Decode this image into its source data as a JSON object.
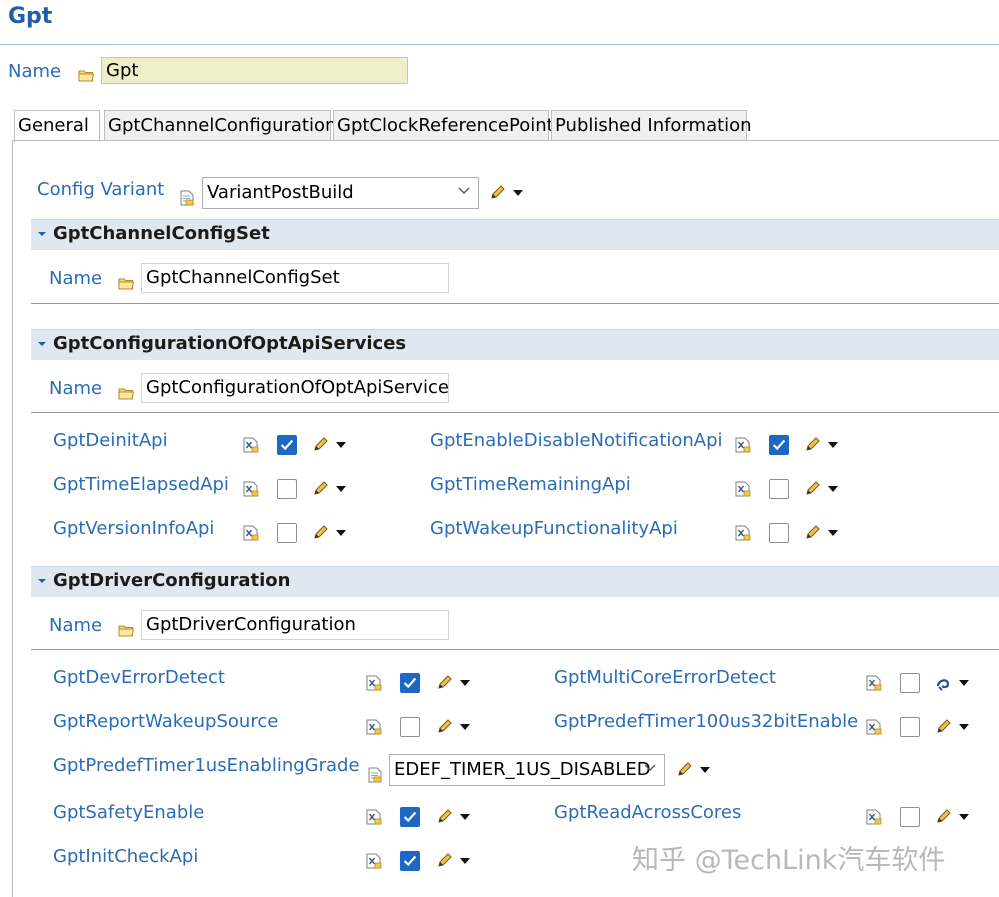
{
  "page_title": "Gpt",
  "name_label": "Name",
  "name_value": "Gpt",
  "tabs": [
    {
      "label": "General",
      "active": true
    },
    {
      "label": "GptChannelConfiguration",
      "active": false
    },
    {
      "label": "GptClockReferencePoint",
      "active": false
    },
    {
      "label": "Published Information",
      "active": false
    }
  ],
  "config_variant": {
    "label": "Config Variant",
    "value": "VariantPostBuild"
  },
  "channel_config_set": {
    "title": "GptChannelConfigSet",
    "name_label": "Name",
    "name_value": "GptChannelConfigSet"
  },
  "opt_api_services": {
    "title": "GptConfigurationOfOptApiServices",
    "name_label": "Name",
    "name_value": "GptConfigurationOfOptApiServices",
    "params": [
      {
        "label": "GptDeinitApi",
        "checked": true
      },
      {
        "label": "GptEnableDisableNotificationApi",
        "checked": true
      },
      {
        "label": "GptTimeElapsedApi",
        "checked": false
      },
      {
        "label": "GptTimeRemainingApi",
        "checked": false
      },
      {
        "label": "GptVersionInfoApi",
        "checked": false
      },
      {
        "label": "GptWakeupFunctionalityApi",
        "checked": false
      }
    ]
  },
  "driver_configuration": {
    "title": "GptDriverConfiguration",
    "name_label": "Name",
    "name_value": "GptDriverConfiguration",
    "params": [
      {
        "label": "GptDevErrorDetect",
        "checked": true
      },
      {
        "label": "GptMultiCoreErrorDetect",
        "checked": false
      },
      {
        "label": "GptReportWakeupSource",
        "checked": false
      },
      {
        "label": "GptPredefTimer100us32bitEnable",
        "checked": false
      },
      {
        "label": "GptSafetyEnable",
        "checked": true
      },
      {
        "label": "GptReadAcrossCores",
        "checked": false
      },
      {
        "label": "GptInitCheckApi",
        "checked": true
      }
    ],
    "enabling_grade": {
      "label": "GptPredefTimer1usEnablingGrade",
      "value": "EDEF_TIMER_1US_DISABLED"
    }
  },
  "watermark": "知乎 @TechLink汽车软件",
  "colors": {
    "accent": "#2a6cb6",
    "checkbox": "#1d68c5",
    "section_bg": "#dfe8f1"
  }
}
